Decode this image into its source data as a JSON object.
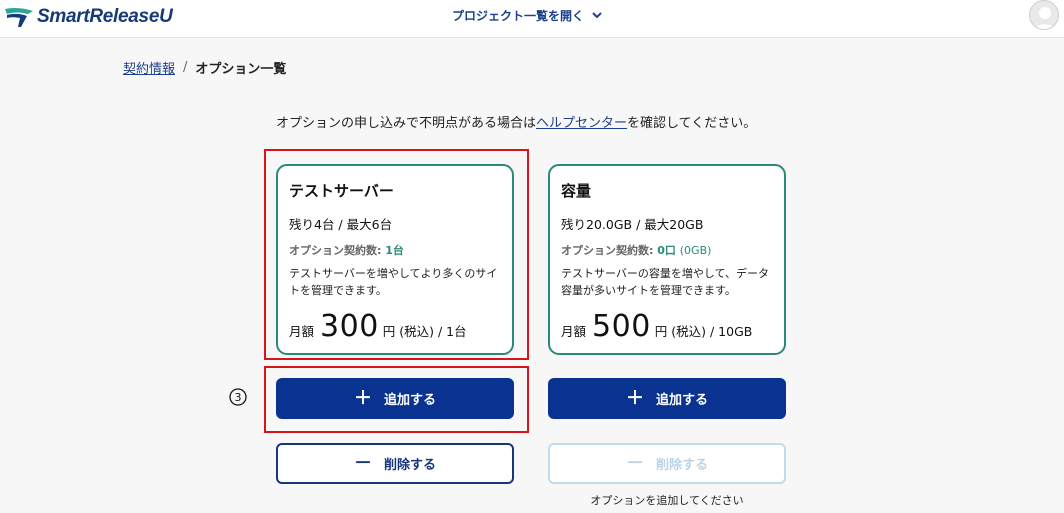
{
  "app": {
    "logo_text": "SmartReleaseU",
    "logo_colors": {
      "navy": "#163a78",
      "teal": "#2aa59a"
    }
  },
  "header": {
    "project_menu_label": "プロジェクト一覧を開く",
    "project_menu_icon": "chevron-down-icon",
    "avatar_icon": "user-avatar-icon"
  },
  "breadcrumb": {
    "parent": "契約情報",
    "separator": "/",
    "current": "オプション一覧"
  },
  "notice": {
    "before": "オプションの申し込みで不明点がある場合は",
    "link": "ヘルプセンター",
    "after": "を確認してください。"
  },
  "options": [
    {
      "title": "テストサーバー",
      "remaining": "残り4台 / 最大6台",
      "count_label": "オプション契約数:",
      "count_value": "1台",
      "count_sub": "",
      "description": "テストサーバーを増やしてより多くのサイトを管理できます。",
      "price_label": "月額",
      "price_amount": "300",
      "price_suffix": "円 (税込) / 1台",
      "add_label": "追加する",
      "delete_label": "削除する",
      "delete_enabled": true,
      "hint": ""
    },
    {
      "title": "容量",
      "remaining": "残り20.0GB / 最大20GB",
      "count_label": "オプション契約数:",
      "count_value": "0口",
      "count_sub": "(0GB)",
      "description": "テストサーバーの容量を増やして、データ容量が多いサイトを管理できます。",
      "price_label": "月額",
      "price_amount": "500",
      "price_suffix": "円 (税込) / 10GB",
      "add_label": "追加する",
      "delete_label": "削除する",
      "delete_enabled": false,
      "hint": "オプションを追加してください"
    }
  ],
  "annotation": {
    "step": "③",
    "highlight_color": "#d9151b"
  },
  "colors": {
    "primary": "#0a3391",
    "accent_teal": "#2a8a78",
    "link": "#1c3f8c",
    "disabled_border": "#bddcf0"
  }
}
